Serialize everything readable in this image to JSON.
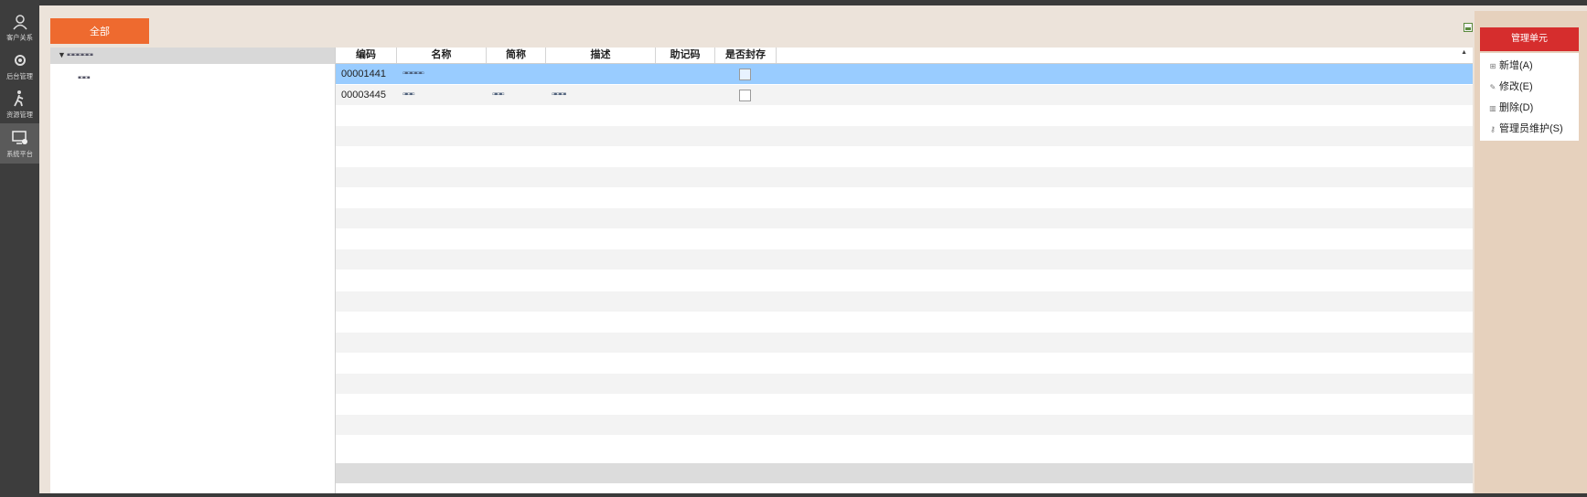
{
  "rail": {
    "items": [
      {
        "label": "客户关系",
        "icon": "user-icon"
      },
      {
        "label": "后台管理",
        "icon": "settings-icon"
      },
      {
        "label": "资源管理",
        "icon": "person-walk-icon"
      },
      {
        "label": "系统平台",
        "icon": "monitor-gear-icon"
      }
    ]
  },
  "toolbar": {
    "all_label": "全部"
  },
  "tree": {
    "root_label": "▪▫▪▫▪▫▪▫▪▫▪",
    "child_label": "▪▫▪▫▪"
  },
  "grid": {
    "columns": [
      "编码",
      "名称",
      "简称",
      "描述",
      "助记码",
      "是否封存"
    ],
    "rows": [
      {
        "code": "00001441",
        "name": "▫▪▫▪▫▪▫▪▫",
        "short": "",
        "desc": "",
        "mnemonic": "",
        "sealed": false,
        "selected": true
      },
      {
        "code": "00003445",
        "name": "▫▪▫▪▫",
        "short": "▫▪▫▪▫",
        "desc": "▫▪▫▪▫▪",
        "mnemonic": "",
        "sealed": false,
        "selected": false
      }
    ]
  },
  "panel": {
    "title": "管理单元",
    "items": [
      {
        "label": "新增(A)",
        "icon": "add-icon"
      },
      {
        "label": "修改(E)",
        "icon": "edit-icon"
      },
      {
        "label": "删除(D)",
        "icon": "delete-icon"
      },
      {
        "label": "管理员维护(S)",
        "icon": "key-icon"
      }
    ]
  },
  "colors": {
    "accent": "#ee6a2f",
    "panel_title": "#d62d2d",
    "selected_row": "#99ccff",
    "background": "#ece3da"
  }
}
